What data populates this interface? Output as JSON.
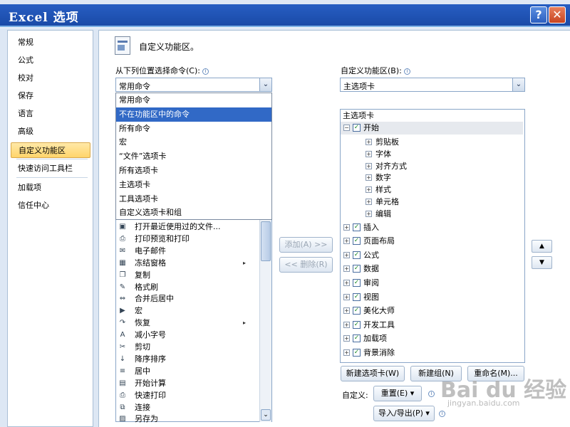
{
  "window": {
    "title": "Excel  选项"
  },
  "nav": {
    "items": [
      "常规",
      "公式",
      "校对",
      "保存",
      "语言",
      "高级",
      "自定义功能区",
      "快速访问工具栏",
      "加载项",
      "信任中心"
    ],
    "selected": "自定义功能区"
  },
  "header": {
    "title": "自定义功能区。"
  },
  "left": {
    "label": "从下列位置选择命令(C):",
    "combo": "常用命令",
    "dropdown": [
      "常用命令",
      "不在功能区中的命令",
      "所有命令",
      "宏",
      "“文件”选项卡",
      "所有选项卡",
      "主选项卡",
      "工具选项卡",
      "自定义选项卡和组"
    ],
    "dropdown_highlight": "不在功能区中的命令",
    "commands": [
      {
        "label": "打开最近使用过的文件...",
        "icon": "open-recent-icon",
        "glyph": "▣"
      },
      {
        "label": "打印预览和打印",
        "icon": "print-preview-icon",
        "glyph": "⎙"
      },
      {
        "label": "电子邮件",
        "icon": "email-icon",
        "glyph": "✉"
      },
      {
        "label": "冻结窗格",
        "icon": "freeze-panes-icon",
        "glyph": "▦",
        "submenu": true
      },
      {
        "label": "复制",
        "icon": "copy-icon",
        "glyph": "❐"
      },
      {
        "label": "格式刷",
        "icon": "format-painter-icon",
        "glyph": "✎"
      },
      {
        "label": "合并后居中",
        "icon": "merge-center-icon",
        "glyph": "⇔"
      },
      {
        "label": "宏",
        "icon": "macro-icon",
        "glyph": "▶"
      },
      {
        "label": "恢复",
        "icon": "redo-icon",
        "glyph": "↷",
        "submenu": true
      },
      {
        "label": "减小字号",
        "icon": "font-decrease-icon",
        "glyph": "A"
      },
      {
        "label": "剪切",
        "icon": "cut-icon",
        "glyph": "✂"
      },
      {
        "label": "降序排序",
        "icon": "sort-desc-icon",
        "glyph": "↓"
      },
      {
        "label": "居中",
        "icon": "align-center-icon",
        "glyph": "≡"
      },
      {
        "label": "开始计算",
        "icon": "calculate-icon",
        "glyph": "▤"
      },
      {
        "label": "快速打印",
        "icon": "quick-print-icon",
        "glyph": "⎙"
      },
      {
        "label": "连接",
        "icon": "connection-icon",
        "glyph": "⧉"
      },
      {
        "label": "另存为",
        "icon": "save-as-icon",
        "glyph": "▨"
      }
    ]
  },
  "middle": {
    "add": "添加(A) >>",
    "remove": "<< 删除(R)"
  },
  "right": {
    "label": "自定义功能区(B):",
    "combo": "主选项卡",
    "tree_header": "主选项卡",
    "tabs": [
      {
        "name": "开始",
        "expanded": true,
        "groups": [
          "剪贴板",
          "字体",
          "对齐方式",
          "数字",
          "样式",
          "单元格",
          "编辑"
        ]
      },
      {
        "name": "插入"
      },
      {
        "name": "页面布局"
      },
      {
        "name": "公式"
      },
      {
        "name": "数据"
      },
      {
        "name": "审阅"
      },
      {
        "name": "视图"
      },
      {
        "name": "美化大师"
      },
      {
        "name": "开发工具"
      },
      {
        "name": "加载项"
      },
      {
        "name": "背景消除"
      }
    ],
    "new_tab": "新建选项卡(W)",
    "new_group": "新建组(N)",
    "rename": "重命名(M)...",
    "customize_label": "自定义:",
    "reset": "重置(E) ▾",
    "import_export": "导入/导出(P) ▾"
  },
  "watermark": {
    "text": "Bai du 经验",
    "url": "jingyan.baidu.com"
  }
}
